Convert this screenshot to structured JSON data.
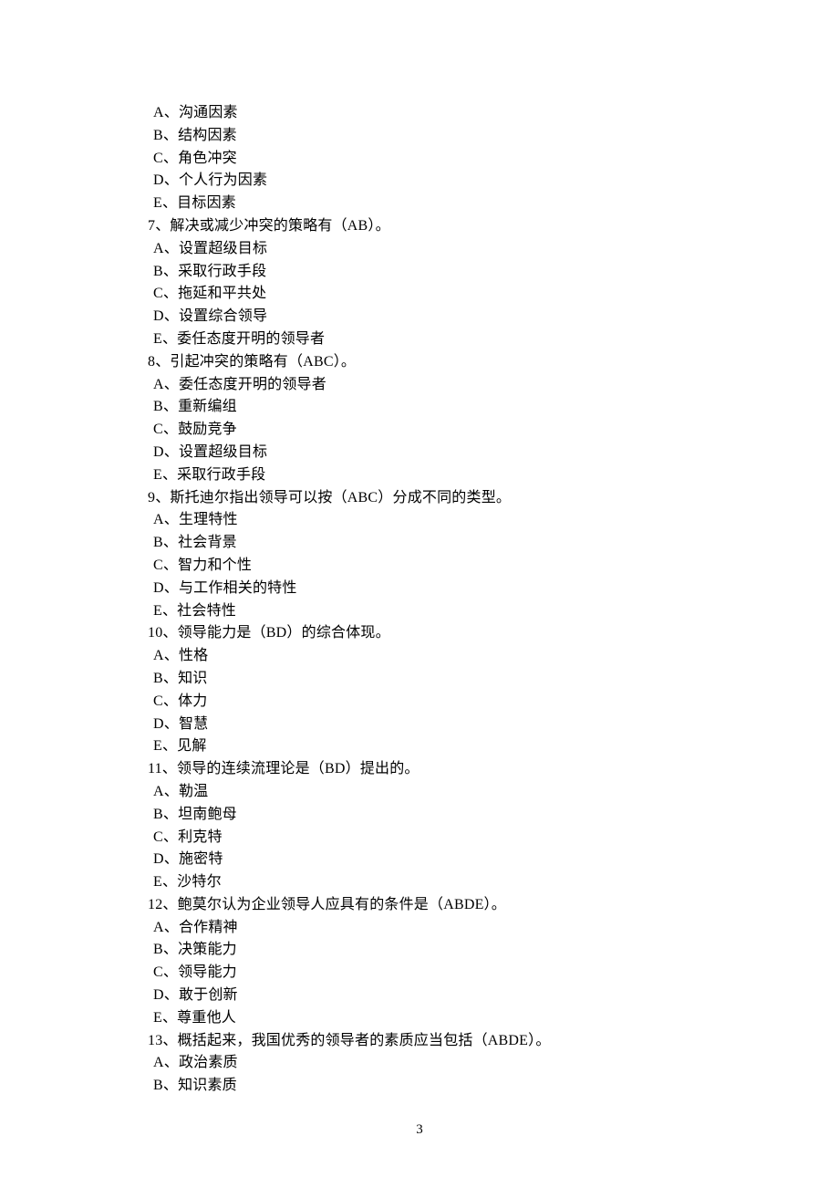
{
  "page_number": "3",
  "preamble_options": {
    "a": "A、沟通因素",
    "b": "B、结构因素",
    "c": "C、角色冲突",
    "d": "D、个人行为因素",
    "e": "E、目标因素"
  },
  "questions": [
    {
      "stem": "7、解决或减少冲突的策略有（AB）。",
      "options": {
        "a": "A、设置超级目标",
        "b": "B、采取行政手段",
        "c": "C、拖延和平共处",
        "d": "D、设置综合领导",
        "e": "E、委任态度开明的领导者"
      }
    },
    {
      "stem": "8、引起冲突的策略有（ABC）。",
      "options": {
        "a": "A、委任态度开明的领导者",
        "b": "B、重新编组",
        "c": "C、鼓励竞争",
        "d": "D、设置超级目标",
        "e": "E、采取行政手段"
      }
    },
    {
      "stem": "9、斯托迪尔指出领导可以按（ABC）分成不同的类型。",
      "options": {
        "a": "A、生理特性",
        "b": "B、社会背景",
        "c": "C、智力和个性",
        "d": "D、与工作相关的特性",
        "e": "E、社会特性"
      }
    },
    {
      "stem": "10、领导能力是（BD）的综合体现。",
      "options": {
        "a": "A、性格",
        "b": "B、知识",
        "c": "C、体力",
        "d": "D、智慧",
        "e": "E、见解"
      }
    },
    {
      "stem": "11、领导的连续流理论是（BD）提出的。",
      "options": {
        "a": "A、勒温",
        "b": "B、坦南鲍母",
        "c": "C、利克特",
        "d": "D、施密特",
        "e": "E、沙特尔"
      }
    },
    {
      "stem": "12、鲍莫尔认为企业领导人应具有的条件是（ABDE）。",
      "options": {
        "a": "A、合作精神",
        "b": "B、决策能力",
        "c": "C、领导能力",
        "d": "D、敢于创新",
        "e": "E、尊重他人"
      }
    },
    {
      "stem": "13、概括起来，我国优秀的领导者的素质应当包括（ABDE）。",
      "options": {
        "a": "A、政治素质",
        "b": "B、知识素质"
      }
    }
  ]
}
